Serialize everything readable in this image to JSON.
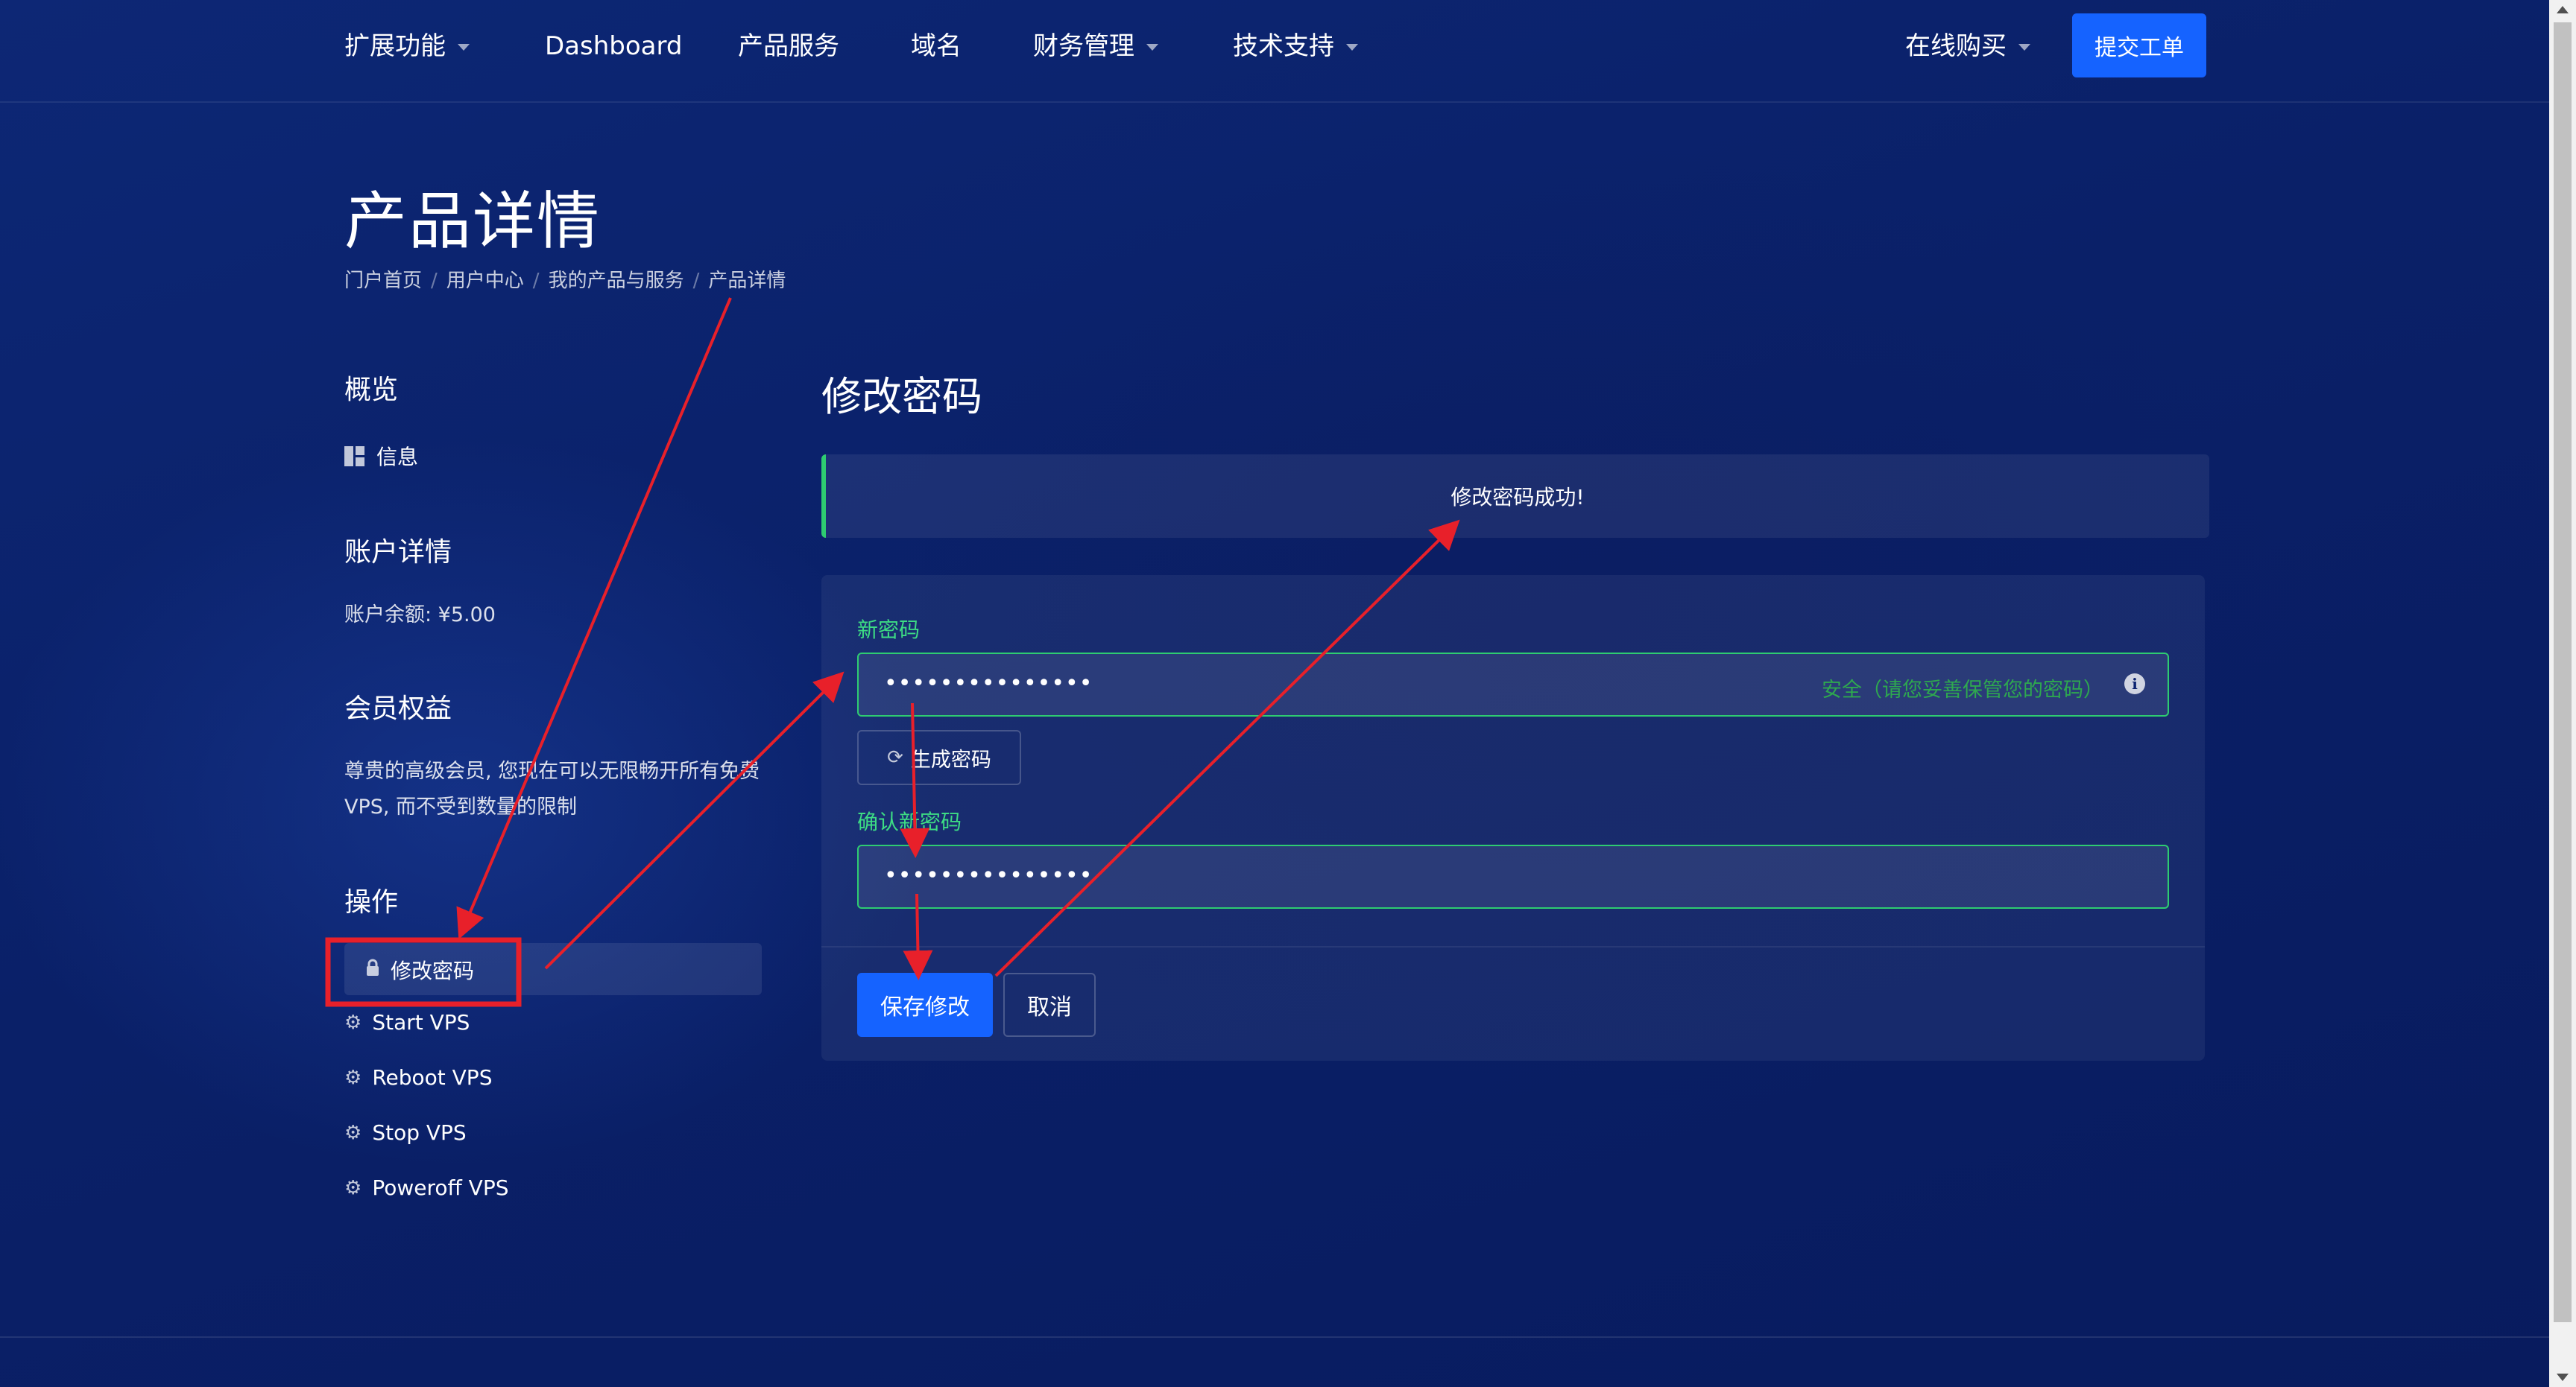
{
  "nav": {
    "items": [
      {
        "label": "扩展功能",
        "dropdown": true
      },
      {
        "label": "Dashboard",
        "dropdown": false
      },
      {
        "label": "产品服务",
        "dropdown": false
      },
      {
        "label": "域名",
        "dropdown": false
      },
      {
        "label": "财务管理",
        "dropdown": true
      },
      {
        "label": "技术支持",
        "dropdown": true
      }
    ],
    "buy_label": "在线购买",
    "ticket_button": "提交工单"
  },
  "page": {
    "title": "产品详情",
    "breadcrumb": [
      "门户首页",
      "用户中心",
      "我的产品与服务",
      "产品详情"
    ]
  },
  "sidebar": {
    "overview_heading": "概览",
    "info_label": "信息",
    "account_heading": "账户详情",
    "balance_text": "账户余额: ¥5.00",
    "member_heading": "会员权益",
    "member_text": "尊贵的高级会员, 您现在可以无限畅开所有免费VPS, 而不受到数量的限制",
    "actions_heading": "操作",
    "actions": [
      {
        "label": "修改密码",
        "icon": "lock-icon"
      },
      {
        "label": "Start VPS",
        "icon": "gears-icon"
      },
      {
        "label": "Reboot VPS",
        "icon": "gears-icon"
      },
      {
        "label": "Stop VPS",
        "icon": "gears-icon"
      },
      {
        "label": "Poweroff VPS",
        "icon": "gears-icon"
      }
    ]
  },
  "main": {
    "section_title": "修改密码",
    "alert_success": "修改密码成功!",
    "new_password_label": "新密码",
    "new_password_value": "•••••••••••••••",
    "strength_hint": "安全（请您妥善保管您的密码）",
    "generate_button": "生成密码",
    "confirm_label": "确认新密码",
    "confirm_value": "•••••••••••••••",
    "save_button": "保存修改",
    "cancel_button": "取消"
  },
  "colors": {
    "background": "#0a2068",
    "primary_button": "#1563ff",
    "success": "#2ecc71",
    "annotation": "#e8202a"
  }
}
